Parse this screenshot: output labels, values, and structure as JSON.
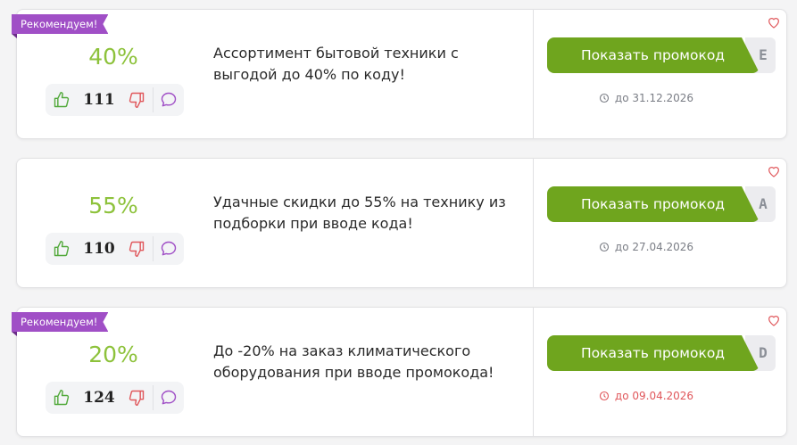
{
  "offers": [
    {
      "badge": "Рекомендуем!",
      "discount": "40%",
      "votes": "111",
      "description": "Ассортимент бытовой техники с выгодой до 40% по коду!",
      "button": "Показать промокод",
      "code_hint": "E",
      "expiry": "до 31.12.2026",
      "expiry_color": "#7a7d85"
    },
    {
      "badge": "",
      "discount": "55%",
      "votes": "110",
      "description": "Удачные скидки до 55% на технику из подборки при вводе кода!",
      "button": "Показать промокод",
      "code_hint": "A",
      "expiry": "до 27.04.2026",
      "expiry_color": "#7a7d85"
    },
    {
      "badge": "Рекомендуем!",
      "discount": "20%",
      "votes": "124",
      "description": "До -20% на заказ климатического оборудования при вводе промокода!",
      "button": "Показать промокод",
      "code_hint": "D",
      "expiry": "до 09.04.2026",
      "expiry_color": "#e0575b"
    }
  ],
  "colors": {
    "accent_green": "#6fa51e",
    "discount_green": "#8dc23b",
    "badge_purple": "#a04fc6",
    "urgent_red": "#e0575b"
  },
  "icons": {
    "like": "thumbs-up-icon",
    "dislike": "thumbs-down-icon",
    "comment": "comment-bubble-icon",
    "favorite": "heart-icon",
    "clock": "clock-icon"
  }
}
